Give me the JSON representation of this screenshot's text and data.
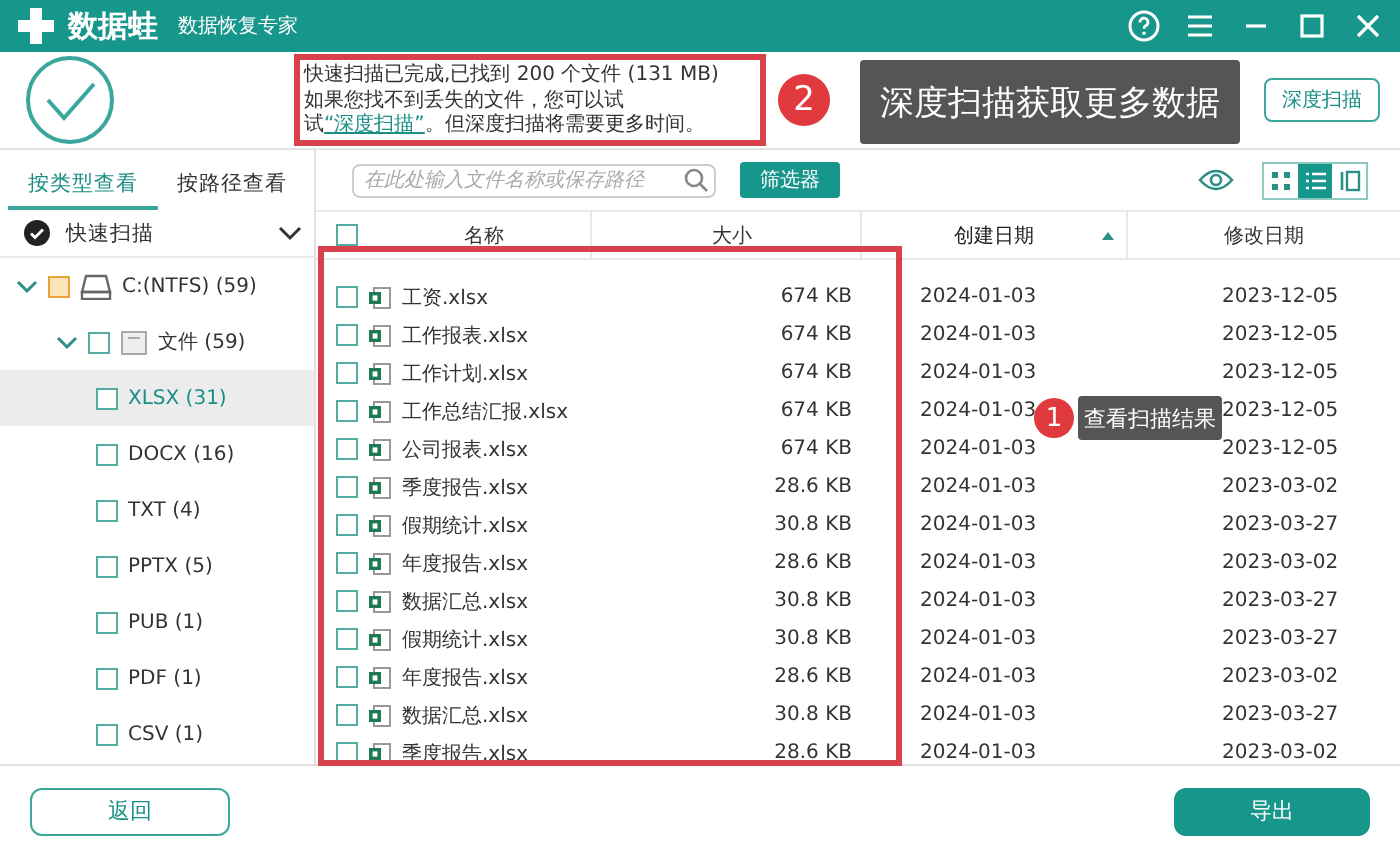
{
  "title_bar": {
    "app_name": "数据蛙",
    "subtitle": "数据恢复专家"
  },
  "scan_summary": {
    "status": "快速扫描已完成,已找到 200 个文件 (131 MB)",
    "hint_before": "如果您找不到丢失的文件，您可以试试",
    "hint_link": "“深度扫描”",
    "hint_after": "。但深度扫描将需要更多时间。",
    "deep_scan_button": "深度扫描"
  },
  "view_tabs": [
    {
      "label": "按类型查看",
      "selected": true
    },
    {
      "label": "按路径查看",
      "selected": false
    }
  ],
  "scan_mode": {
    "label": "快速扫描"
  },
  "tree": [
    {
      "label": "C:(NTFS) (59)",
      "kind": "drive",
      "checked": false,
      "partial": true,
      "expanded": true,
      "selected": false,
      "children": [
        {
          "label": "文件 (59)",
          "kind": "folder",
          "checked": false,
          "partial": false,
          "expanded": true,
          "selected": false,
          "children": [
            {
              "label": "XLSX (31)",
              "kind": "type",
              "checked": false,
              "partial": false,
              "selected": true
            },
            {
              "label": "DOCX (16)",
              "kind": "type",
              "checked": false,
              "partial": false,
              "selected": false
            },
            {
              "label": "TXT (4)",
              "kind": "type",
              "checked": false,
              "partial": false,
              "selected": false
            },
            {
              "label": "PPTX (5)",
              "kind": "type",
              "checked": false,
              "partial": false,
              "selected": false
            },
            {
              "label": "PUB (1)",
              "kind": "type",
              "checked": false,
              "partial": false,
              "selected": false
            },
            {
              "label": "PDF (1)",
              "kind": "type",
              "checked": false,
              "partial": false,
              "selected": false
            },
            {
              "label": "CSV (1)",
              "kind": "type",
              "checked": false,
              "partial": false,
              "selected": false
            }
          ]
        }
      ]
    }
  ],
  "search": {
    "placeholder": "在此处输入文件名称或保存路径"
  },
  "filter_button": "筛选器",
  "view_modes": [
    {
      "kind": "grid",
      "selected": false
    },
    {
      "kind": "list",
      "selected": true
    },
    {
      "kind": "detail",
      "selected": false
    }
  ],
  "table": {
    "select_all": {
      "checked": false
    },
    "columns": [
      {
        "label": "名称",
        "sorted": false
      },
      {
        "label": "大小",
        "sorted": false
      },
      {
        "label": "创建日期",
        "sorted": true
      },
      {
        "label": "修改日期",
        "sorted": false
      }
    ],
    "rows": [
      {
        "name": "工资.xlsx",
        "size": "674 KB",
        "created": "2024-01-03",
        "modified": "2023-12-05",
        "checked": false
      },
      {
        "name": "工作报表.xlsx",
        "size": "674 KB",
        "created": "2024-01-03",
        "modified": "2023-12-05",
        "checked": false
      },
      {
        "name": "工作计划.xlsx",
        "size": "674 KB",
        "created": "2024-01-03",
        "modified": "2023-12-05",
        "checked": false
      },
      {
        "name": "工作总结汇报.xlsx",
        "size": "674 KB",
        "created": "2024-01-03",
        "modified": "2023-12-05",
        "checked": false
      },
      {
        "name": "公司报表.xlsx",
        "size": "674 KB",
        "created": "2024-01-03",
        "modified": "2023-12-05",
        "checked": false
      },
      {
        "name": "季度报告.xlsx",
        "size": "28.6 KB",
        "created": "2024-01-03",
        "modified": "2023-03-02",
        "checked": false
      },
      {
        "name": "假期统计.xlsx",
        "size": "30.8 KB",
        "created": "2024-01-03",
        "modified": "2023-03-27",
        "checked": false
      },
      {
        "name": "年度报告.xlsx",
        "size": "28.6 KB",
        "created": "2024-01-03",
        "modified": "2023-03-02",
        "checked": false
      },
      {
        "name": "数据汇总.xlsx",
        "size": "30.8 KB",
        "created": "2024-01-03",
        "modified": "2023-03-27",
        "checked": false
      },
      {
        "name": "假期统计.xlsx",
        "size": "30.8 KB",
        "created": "2024-01-03",
        "modified": "2023-03-27",
        "checked": false
      },
      {
        "name": "年度报告.xlsx",
        "size": "28.6 KB",
        "created": "2024-01-03",
        "modified": "2023-03-02",
        "checked": false
      },
      {
        "name": "数据汇总.xlsx",
        "size": "30.8 KB",
        "created": "2024-01-03",
        "modified": "2023-03-27",
        "checked": false
      },
      {
        "name": "季度报告.xlsx",
        "size": "28.6 KB",
        "created": "2024-01-03",
        "modified": "2023-03-02",
        "checked": false
      }
    ]
  },
  "footer": {
    "back_button": "返回",
    "export_button": "导出"
  },
  "annotations": [
    {
      "number": "2",
      "text": "深度扫描获取更多数据"
    },
    {
      "number": "1",
      "text": "查看扫描结果"
    }
  ]
}
